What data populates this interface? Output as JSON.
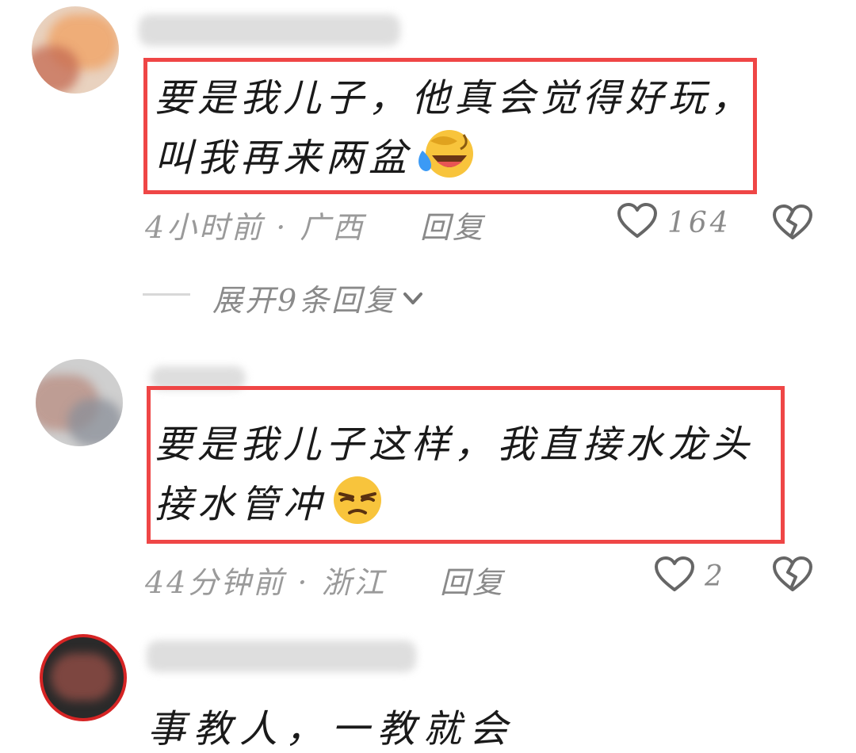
{
  "comments": [
    {
      "text_line1": "要是我儿子，他真会觉得好玩，",
      "text_line2": "叫我再来两盆",
      "emoji": "laughing-crying-emoji",
      "time_location": "4小时前 · 广西",
      "reply_label": "回复",
      "like_count": "164",
      "expand_label": "展开9条回复"
    },
    {
      "text_line1": "要是我儿子这样，我直接水龙头",
      "text_line2": "接水管冲",
      "emoji": "unamused-emoji",
      "time_location": "44分钟前 · 浙江",
      "reply_label": "回复",
      "like_count": "2"
    },
    {
      "text_line1": "事教人，一教就会"
    }
  ],
  "colors": {
    "highlight_box": "#ef4646",
    "meta_text": "#9a9a9a"
  }
}
